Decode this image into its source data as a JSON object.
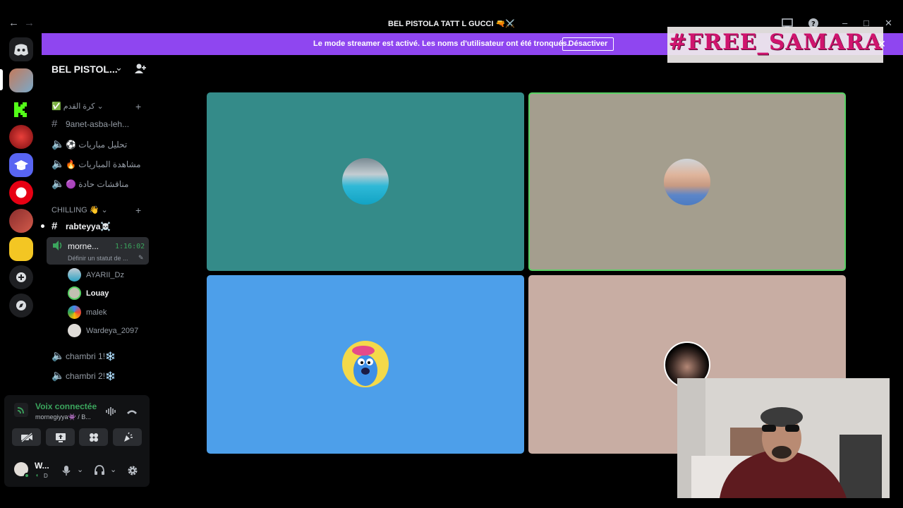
{
  "window": {
    "title": "BEL PISTOLA TATT L GUCCI 🔫⚔️",
    "back_icon": "←",
    "forward_icon": "→"
  },
  "banner": {
    "text": "Le mode streamer est activé. Les noms d'utilisateur ont été tronqués.",
    "button": "Désactiver",
    "overlay": "#FREE_SAMARA",
    "close": "✕"
  },
  "server": {
    "name": "BEL PISTOL...",
    "categories": [
      {
        "label": "✅ كرة القدم ⌄"
      },
      {
        "label": "CHILLING 👋 ⌄"
      }
    ],
    "channels": [
      {
        "name": "9anet-asba-leh...",
        "type": "text"
      },
      {
        "name": "⚽ تحليل مباريات",
        "type": "voice"
      },
      {
        "name": "🔥 مشاهدة المباريات",
        "type": "voice"
      },
      {
        "name": "🟣 مناقشات حادة",
        "type": "voice"
      },
      {
        "name": "rabteyya☠️",
        "type": "text"
      },
      {
        "name": "morne...",
        "type": "voice",
        "timer": "1:16:02",
        "status": "Définir un statut de ..."
      },
      {
        "name": "chambri 1!❄️",
        "type": "voice"
      },
      {
        "name": "chambri 2!❄️",
        "type": "voice"
      }
    ],
    "voice_users": [
      "AYARII_Dz",
      "Louay",
      "malek",
      "Wardeya_2097"
    ]
  },
  "voice_panel": {
    "status": "Voix connectée",
    "channel": "mornegiyya👾 / B..."
  },
  "user": {
    "name": "W...",
    "tag": "D"
  },
  "colors": {
    "banner": "#8f46f0",
    "overlay_text": "#d0146e",
    "tile1": "#348b89",
    "tile2": "#a49e8e",
    "tile3": "#4d9fea",
    "tile4": "#c8ada3",
    "speaking_border": "#57d163",
    "connected": "#3ba55d"
  }
}
